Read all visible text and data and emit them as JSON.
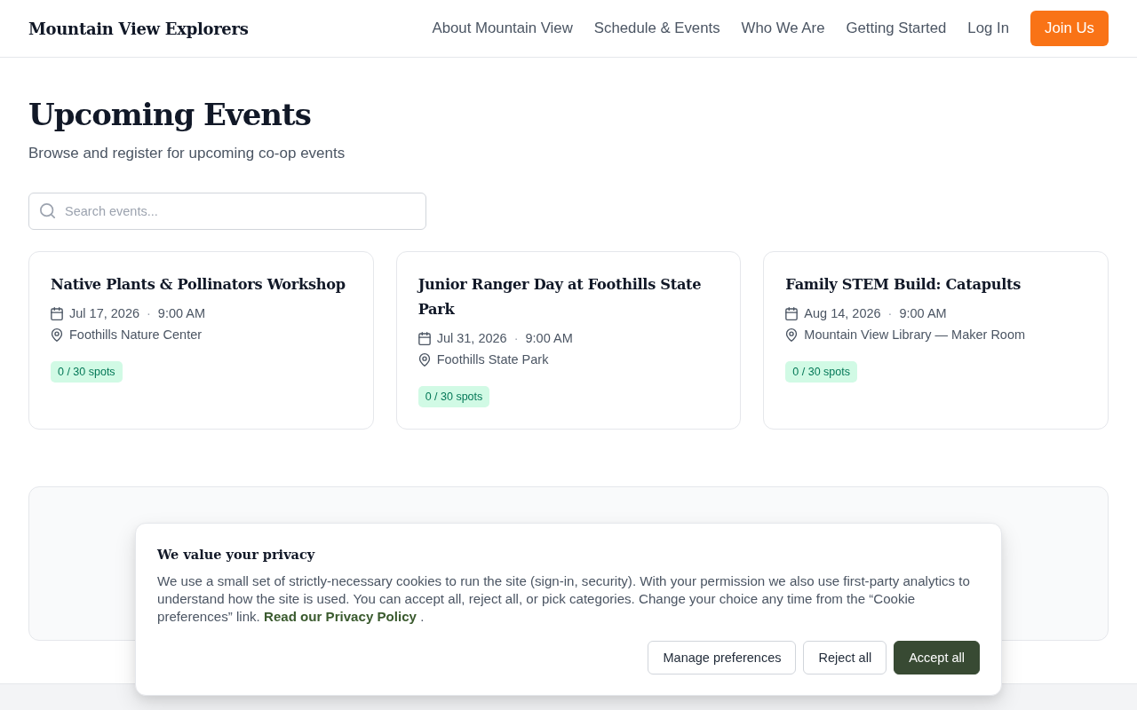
{
  "header": {
    "logo": "Mountain View Explorers",
    "nav": [
      {
        "label": "About Mountain View"
      },
      {
        "label": "Schedule & Events"
      },
      {
        "label": "Who We Are"
      },
      {
        "label": "Getting Started"
      },
      {
        "label": "Log In"
      }
    ],
    "cta": "Join Us"
  },
  "page": {
    "title": "Upcoming Events",
    "subtitle": "Browse and register for upcoming co-op events",
    "search": {
      "placeholder": "Search events..."
    }
  },
  "events": [
    {
      "title": "Native Plants & Pollinators Workshop",
      "date": "Jul 17, 2026",
      "separator": "·",
      "time": "9:00 AM",
      "location": "Foothills Nature Center",
      "spots": "0 / 30 spots"
    },
    {
      "title": "Junior Ranger Day at Foothills State Park",
      "date": "Jul 31, 2026",
      "separator": "·",
      "time": "9:00 AM",
      "location": "Foothills State Park",
      "spots": "0 / 30 spots"
    },
    {
      "title": "Family STEM Build: Catapults",
      "date": "Aug 14, 2026",
      "separator": "·",
      "time": "9:00 AM",
      "location": "Mountain View Library — Maker Room",
      "spots": "0 / 30 spots"
    }
  ],
  "cookie_banner": {
    "title": "We value your privacy",
    "text": "We use a small set of strictly-necessary cookies to run the site (sign-in, security). With your permission we also use first-party analytics to understand how the site is used. You can accept all, reject all, or pick categories. Change your choice any time from the “Cookie preferences” link.",
    "link": "Read our Privacy Policy",
    "text_after": ".",
    "buttons": [
      {
        "label": "Manage preferences",
        "kind": "secondary"
      },
      {
        "label": "Reject all",
        "kind": "secondary"
      },
      {
        "label": "Accept all",
        "kind": "primary"
      }
    ]
  }
}
